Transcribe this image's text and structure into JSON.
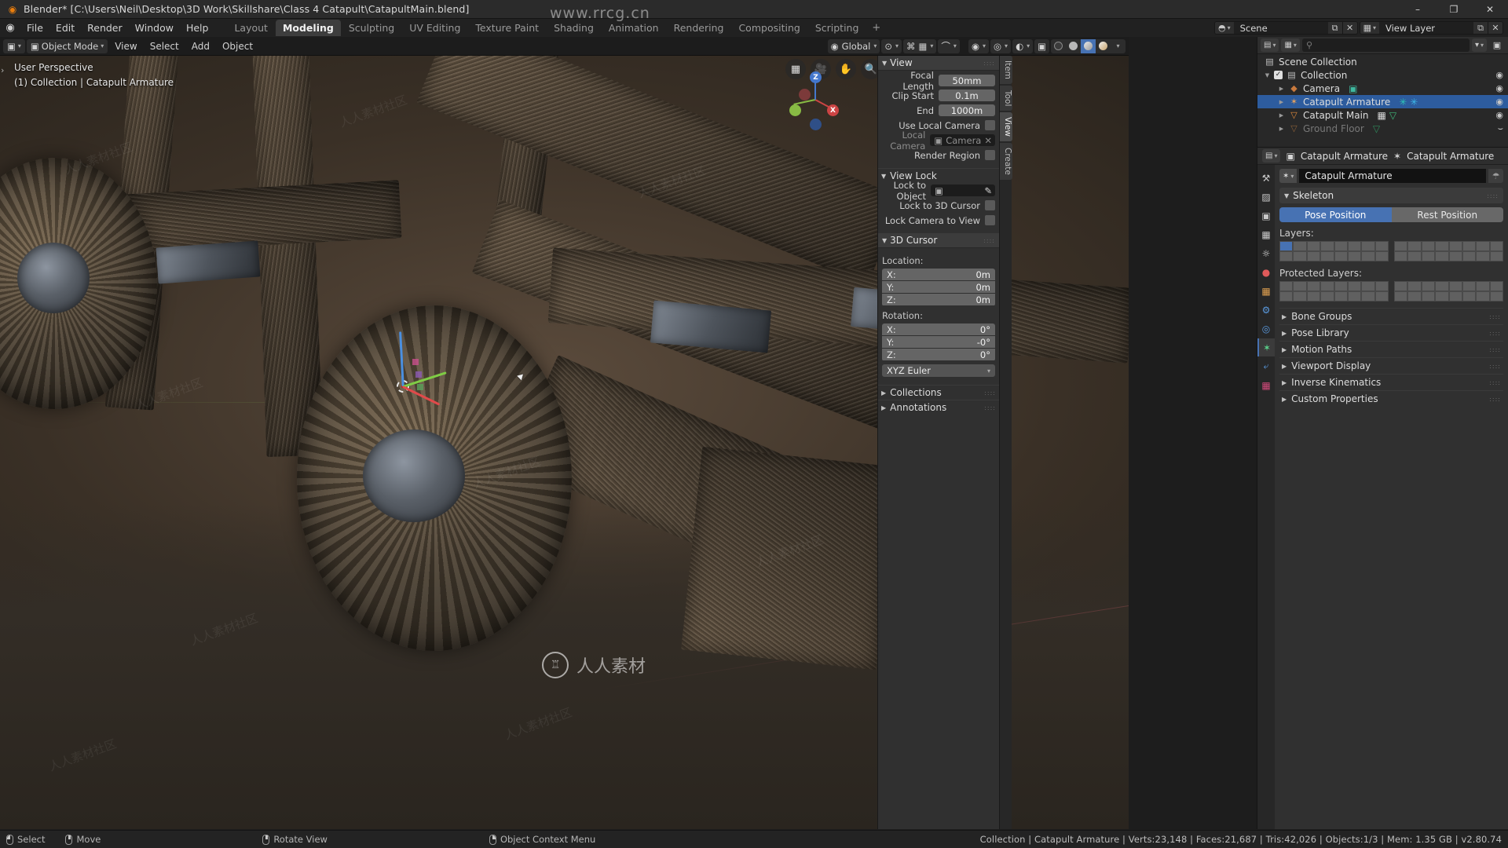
{
  "titlebar": {
    "title": "Blender* [C:\\Users\\Neil\\Desktop\\3D Work\\Skillshare\\Class 4 Catapult\\CatapultMain.blend]",
    "minimize": "–",
    "maximize": "❐",
    "close": "✕"
  },
  "menus": [
    "File",
    "Edit",
    "Render",
    "Window",
    "Help"
  ],
  "workspaces": {
    "tabs": [
      "Layout",
      "Modeling",
      "Sculpting",
      "UV Editing",
      "Texture Paint",
      "Shading",
      "Animation",
      "Rendering",
      "Compositing",
      "Scripting"
    ],
    "active": "Modeling",
    "add": "+"
  },
  "topbar_right": {
    "scene_label": "Scene",
    "viewlayer_label": "View Layer",
    "new_icon": "⧉",
    "close_icon": "✕"
  },
  "viewport_header": {
    "mode": "Object Mode",
    "menus": [
      "View",
      "Select",
      "Add",
      "Object"
    ],
    "transform_orientation": "Global",
    "proportional_label": "",
    "snap_icon": "▦",
    "pivot_icon": "⊙",
    "magnet_icon": "⌘",
    "falloff_icon": "⌒"
  },
  "viewport_overlay": {
    "perspective": "User Perspective",
    "scene_info": "(1) Collection | Catapult Armature"
  },
  "gizmo": {
    "x_label": "X",
    "y_label": "Y",
    "z_label": "Z",
    "x_color": "#cc4444",
    "y_color": "#88bb44",
    "z_color": "#4477cc"
  },
  "nav_buttons": [
    "grid-icon",
    "camera-icon",
    "hand-icon",
    "zoom-icon"
  ],
  "npanel": {
    "tabs": [
      "Item",
      "Tool",
      "View",
      "Create"
    ],
    "active_tab": "View",
    "view_panel": {
      "title": "View",
      "focal_length_label": "Focal Length",
      "focal_length_value": "50mm",
      "clip_start_label": "Clip Start",
      "clip_start_value": "0.1m",
      "clip_end_label": "End",
      "clip_end_value": "1000m",
      "use_local_camera_label": "Use Local Camera",
      "local_camera_label": "Local Camera",
      "local_camera_value": "Camera",
      "render_region_label": "Render Region"
    },
    "view_lock": {
      "title": "View Lock",
      "lock_to_object_label": "Lock to Object",
      "lock_to_3d_cursor_label": "Lock to 3D Cursor",
      "lock_camera_to_view_label": "Lock Camera to View"
    },
    "cursor3d": {
      "title": "3D Cursor",
      "location_label": "Location:",
      "location": [
        {
          "axis": "X:",
          "value": "0m"
        },
        {
          "axis": "Y:",
          "value": "0m"
        },
        {
          "axis": "Z:",
          "value": "0m"
        }
      ],
      "rotation_label": "Rotation:",
      "rotation": [
        {
          "axis": "X:",
          "value": "0°"
        },
        {
          "axis": "Y:",
          "value": "-0°"
        },
        {
          "axis": "Z:",
          "value": "0°"
        }
      ],
      "rotation_mode": "XYZ Euler"
    },
    "collapsed": [
      "Collections",
      "Annotations"
    ]
  },
  "outliner": {
    "display_mode_icon": "view-layer-icon",
    "filter_icon": "filter-icon",
    "new_collection_icon": "new-collection-icon",
    "search_placeholder": "",
    "rows": [
      {
        "label": "Scene Collection",
        "indent": 0,
        "icon": "☷",
        "icon_color": "#c0c0c0",
        "selected": false,
        "dim": false,
        "has_check": false,
        "has_disc": false,
        "eye": "◉",
        "sub_icons": []
      },
      {
        "label": "Collection",
        "indent": 1,
        "icon": "☷",
        "icon_color": "#c0c0c0",
        "selected": false,
        "dim": false,
        "has_check": true,
        "has_disc": true,
        "disc": "▼",
        "eye": "◉",
        "sub_icons": []
      },
      {
        "label": "Camera",
        "indent": 2,
        "icon": "◈",
        "icon_color": "#c97a3e",
        "selected": false,
        "dim": false,
        "has_check": false,
        "has_disc": true,
        "disc": "▶",
        "eye": "◉",
        "sub_icons": [
          {
            "glyph": "▣",
            "color": "#3fb9a0"
          }
        ]
      },
      {
        "label": "Catapult Armature",
        "indent": 2,
        "icon": "✶",
        "icon_color": "#e0a060",
        "selected": true,
        "dim": false,
        "has_check": false,
        "has_disc": true,
        "disc": "▶",
        "eye": "◉",
        "sub_icons": [
          {
            "glyph": "✳",
            "color": "#2ec4b6"
          },
          {
            "glyph": "✳",
            "color": "#3db8e8"
          }
        ]
      },
      {
        "label": "Catapult Main",
        "indent": 2,
        "icon": "▽",
        "icon_color": "#e08a3c",
        "selected": false,
        "dim": false,
        "has_check": false,
        "has_disc": true,
        "disc": "▶",
        "eye": "◉",
        "sub_icons": [
          {
            "glyph": "▦",
            "color": "#d8d8d8"
          },
          {
            "glyph": "▽",
            "color": "#3fb97a"
          }
        ]
      },
      {
        "label": "Ground Floor",
        "indent": 2,
        "icon": "▽",
        "icon_color": "#8a6038",
        "selected": false,
        "dim": true,
        "has_check": false,
        "has_disc": true,
        "disc": "▶",
        "eye": "⌣",
        "sub_icons": [
          {
            "glyph": "▽",
            "color": "#2f8a5c"
          }
        ]
      }
    ]
  },
  "properties": {
    "breadcrumb": [
      {
        "icon": "▣",
        "label": "Catapult Armature"
      },
      {
        "icon": "✶",
        "label": "Catapult Armature"
      }
    ],
    "id_name": "Catapult Armature",
    "id_icon": "✶",
    "shield_icon": "⛨",
    "tabs": [
      {
        "name": "tool-tab",
        "glyph": "⚒",
        "color": "#c8c8c8",
        "active": false
      },
      {
        "name": "render-tab",
        "glyph": "▤",
        "color": "#c8c8c8",
        "active": false
      },
      {
        "name": "output-tab",
        "glyph": "⎙",
        "color": "#c8c8c8",
        "active": false
      },
      {
        "name": "view-layer-tab",
        "glyph": "▣",
        "color": "#c8c8c8",
        "active": false
      },
      {
        "name": "scene-tab",
        "glyph": "◔",
        "color": "#d8d8d8",
        "active": false
      },
      {
        "name": "world-tab",
        "glyph": "●",
        "color": "#e05a5a",
        "active": false
      },
      {
        "name": "object-tab",
        "glyph": "▧",
        "color": "#e0a050",
        "active": false
      },
      {
        "name": "modifier-tab",
        "glyph": "⌾",
        "color": "#5a9ae0",
        "active": false
      },
      {
        "name": "physics-tab",
        "glyph": "◌",
        "color": "#5a9ae0",
        "active": false
      },
      {
        "name": "armature-data-tab",
        "glyph": "✶",
        "color": "#5ad08a",
        "active": true
      },
      {
        "name": "constraint-tab",
        "glyph": "⧉",
        "color": "#5a9ae0",
        "active": false
      },
      {
        "name": "texture-tab",
        "glyph": "▓",
        "color": "#d04a7a",
        "active": false
      }
    ],
    "skeleton": {
      "title": "Skeleton",
      "pose_position": "Pose Position",
      "rest_position": "Rest Position",
      "active_position": "Pose Position",
      "layers_label": "Layers:",
      "protected_layers_label": "Protected Layers:",
      "layers_active_index": 0
    },
    "collapsed_panels": [
      "Bone Groups",
      "Pose Library",
      "Motion Paths",
      "Viewport Display",
      "Inverse Kinematics",
      "Custom Properties"
    ]
  },
  "statusbar": {
    "hints": [
      {
        "mouse": "l",
        "label": "Select"
      },
      {
        "mouse": "m",
        "label": "Move"
      },
      {
        "mouse": "m",
        "label": "Rotate View"
      },
      {
        "mouse": "r",
        "label": "Object Context Menu"
      }
    ],
    "info": "Collection | Catapult Armature | Verts:23,148 | Faces:21,687 | Tris:42,026 | Objects:1/3 | Mem: 1.35 GB | v2.80.74"
  },
  "watermarks": {
    "top": "www.rrcg.cn",
    "bottom": "人人素材",
    "tile": "人人素材社区"
  },
  "colors": {
    "accent_blue": "#4772b3",
    "selection_blue": "#2d5c9e",
    "panel_bg": "#303030",
    "header_bg": "#212121"
  }
}
